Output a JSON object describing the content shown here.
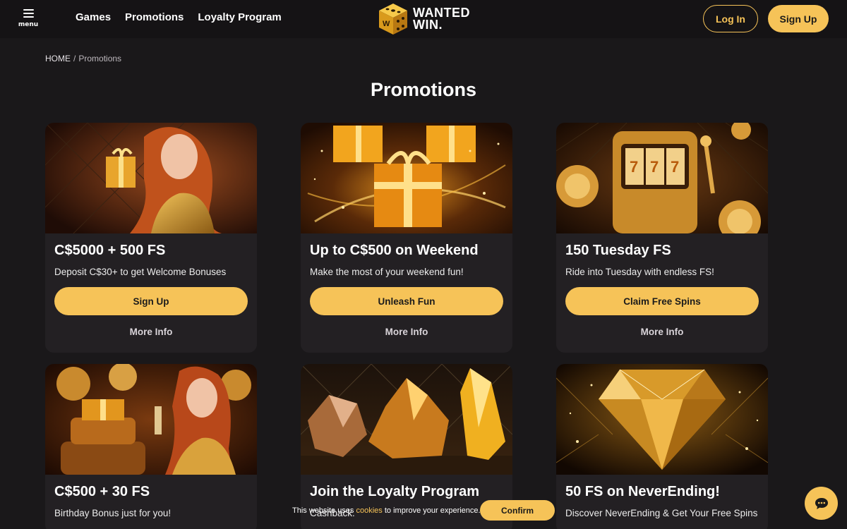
{
  "header": {
    "menu_label": "menu",
    "nav": [
      "Games",
      "Promotions",
      "Loyalty Program"
    ],
    "logo_line1": "WANTED",
    "logo_line2": "WIN.",
    "login_label": "Log In",
    "signup_label": "Sign Up"
  },
  "breadcrumb": {
    "home": "HOME",
    "separator": "/",
    "current": "Promotions"
  },
  "page_title": "Promotions",
  "promotions": [
    {
      "title": "C$5000 + 500 FS",
      "description": "Deposit C$30+ to get Welcome Bonuses",
      "cta": "Sign Up",
      "more": "More Info",
      "image": "woman-with-gift-image"
    },
    {
      "title": "Up to C$500 on Weekend",
      "description": "Make the most of your weekend fun!",
      "cta": "Unleash Fun",
      "more": "More Info",
      "image": "golden-gift-boxes-image"
    },
    {
      "title": "150 Tuesday FS",
      "description": "Ride into Tuesday with endless FS!",
      "cta": "Claim Free Spins",
      "more": "More Info",
      "image": "golden-slot-machine-image"
    },
    {
      "title": "C$500 + 30 FS",
      "description": "Birthday Bonus just for you!",
      "image": "birthday-cake-woman-image"
    },
    {
      "title": "Join the Loyalty Program",
      "description": "Cashback.",
      "image": "golden-crystals-image"
    },
    {
      "title": "50 FS on NeverEnding!",
      "description": "Discover NeverEnding & Get Your Free Spins",
      "image": "golden-diamond-image"
    }
  ],
  "cookie_banner": {
    "text_before": "This website uses",
    "link": "cookies",
    "text_after": "to improve your experience.",
    "confirm_label": "Confirm"
  },
  "colors": {
    "accent": "#f6c358",
    "background": "#1a181a",
    "card": "#232023",
    "header": "#151315"
  },
  "icons": {
    "menu": "hamburger-icon",
    "chat": "chat-bubble-icon",
    "logo": "dice-logo-icon"
  }
}
